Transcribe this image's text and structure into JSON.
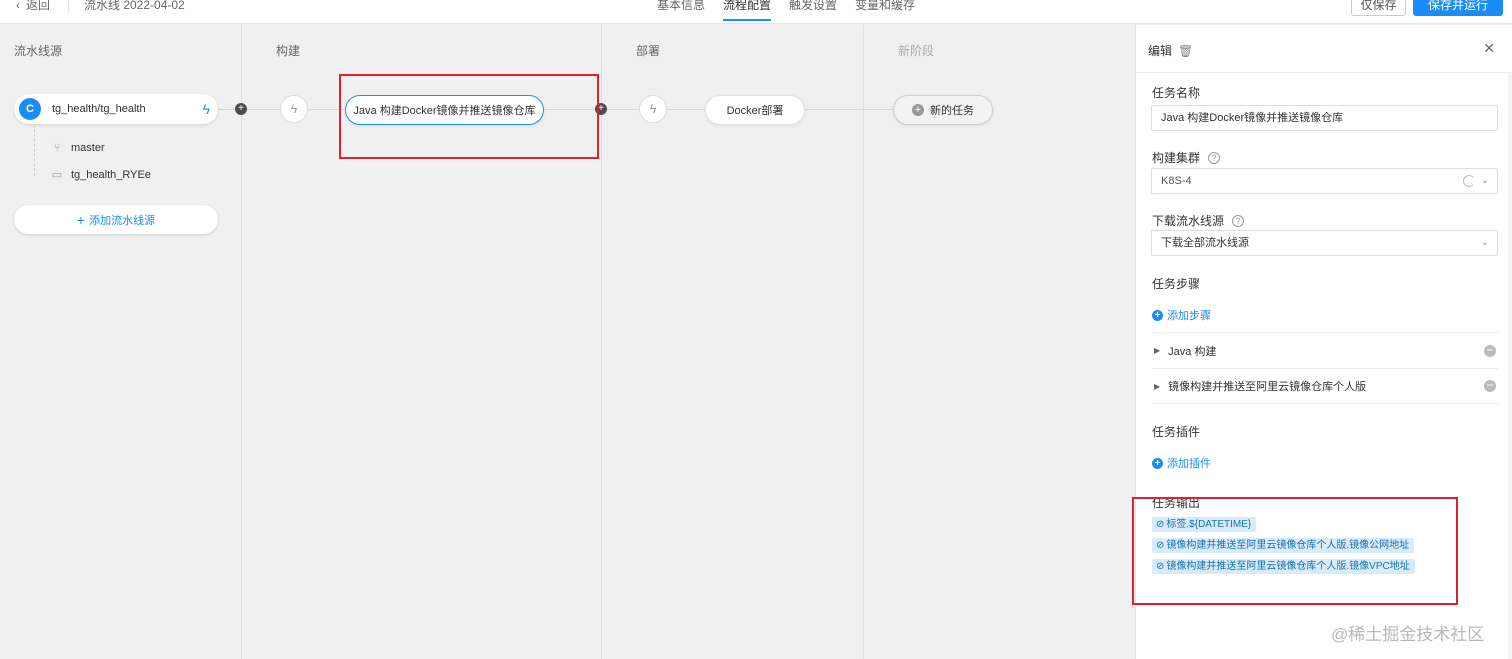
{
  "topbar": {
    "back_label": "返回",
    "pipeline_name": "流水线 2022-04-02",
    "tabs": [
      {
        "label": "基本信息"
      },
      {
        "label": "流程配置"
      },
      {
        "label": "触发设置"
      },
      {
        "label": "变量和缓存"
      }
    ],
    "active_tab": "流程配置",
    "save_only_label": "仅保存",
    "save_run_label": "保存并运行"
  },
  "canvas": {
    "columns": [
      {
        "title": "流水线源"
      },
      {
        "title": "构建"
      },
      {
        "title": "部署"
      },
      {
        "title": "新阶段"
      }
    ],
    "source": {
      "name": "tg_health/tg_health",
      "logo_letter": "C",
      "branch": "master",
      "folder": "tg_health_RYEe",
      "add_label": "添加流水线源"
    },
    "build_task": "Java 构建Docker镜像并推送镜像仓库",
    "deploy_task": "Docker部署",
    "new_task": "新的任务"
  },
  "panel": {
    "title": "编辑",
    "task_name_label": "任务名称",
    "task_name_value": "Java 构建Docker镜像并推送镜像仓库",
    "cluster_label": "构建集群",
    "cluster_value": "K8S-4",
    "download_label": "下载流水线源",
    "download_value": "下载全部流水线源",
    "steps_label": "任务步骤",
    "add_step_label": "添加步骤",
    "steps": [
      {
        "label": "Java 构建"
      },
      {
        "label": "镜像构建并推送至阿里云镜像仓库个人版"
      }
    ],
    "plugins_label": "任务插件",
    "add_plugin_label": "添加插件",
    "outputs_label": "任务输出",
    "outputs": [
      {
        "label": "标签.${DATETIME}"
      },
      {
        "label": "镜像构建并推送至阿里云镜像仓库个人版.镜像公网地址"
      },
      {
        "label": "镜像构建并推送至阿里云镜像仓库个人版.镜像VPC地址"
      }
    ]
  },
  "watermark": "@稀土掘金技术社区",
  "colors": {
    "accent": "#1a8cf5",
    "highlight_box": "#e0202a"
  }
}
